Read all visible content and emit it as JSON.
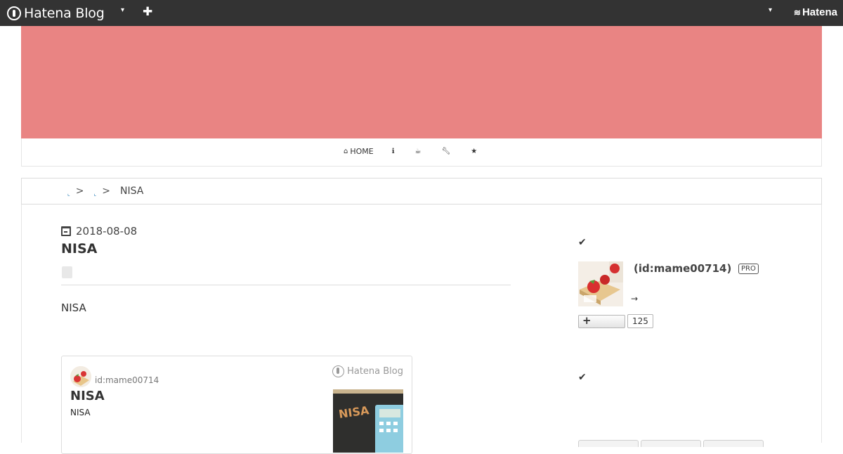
{
  "topbar": {
    "brand": "Hatena Blog",
    "right_logo": "Hatena",
    "icons": [
      "hatena-blog-logo-icon",
      "caret-down-icon",
      "plus-icon",
      "caret-down-icon",
      "hatena-wave-icon"
    ]
  },
  "colors": {
    "topbar_bg": "#333333",
    "banner_bg": "#e98483",
    "link": "#2a80b9"
  },
  "nav": {
    "items": [
      {
        "icon": "home-icon",
        "label": "HOME"
      },
      {
        "icon": "info-icon",
        "label": ""
      },
      {
        "icon": "coffee-icon",
        "label": ""
      },
      {
        "icon": "wrench-icon",
        "label": ""
      },
      {
        "icon": "star-icon",
        "label": ""
      }
    ]
  },
  "breadcrumb": {
    "links": [
      "",
      ""
    ],
    "separator": ">",
    "current": "NISA"
  },
  "entry": {
    "date": "2018-08-08",
    "title": "NISA",
    "body": "NISA"
  },
  "embed_card": {
    "user": "id:mame00714",
    "title": "NISA",
    "description": "NISA",
    "brand": "Hatena Blog",
    "thumb_text": "NISA"
  },
  "sidebar": {
    "profile": {
      "id": "(id:mame00714)",
      "badge": "PRO",
      "link_arrow": "→",
      "reader_count": "125"
    }
  }
}
